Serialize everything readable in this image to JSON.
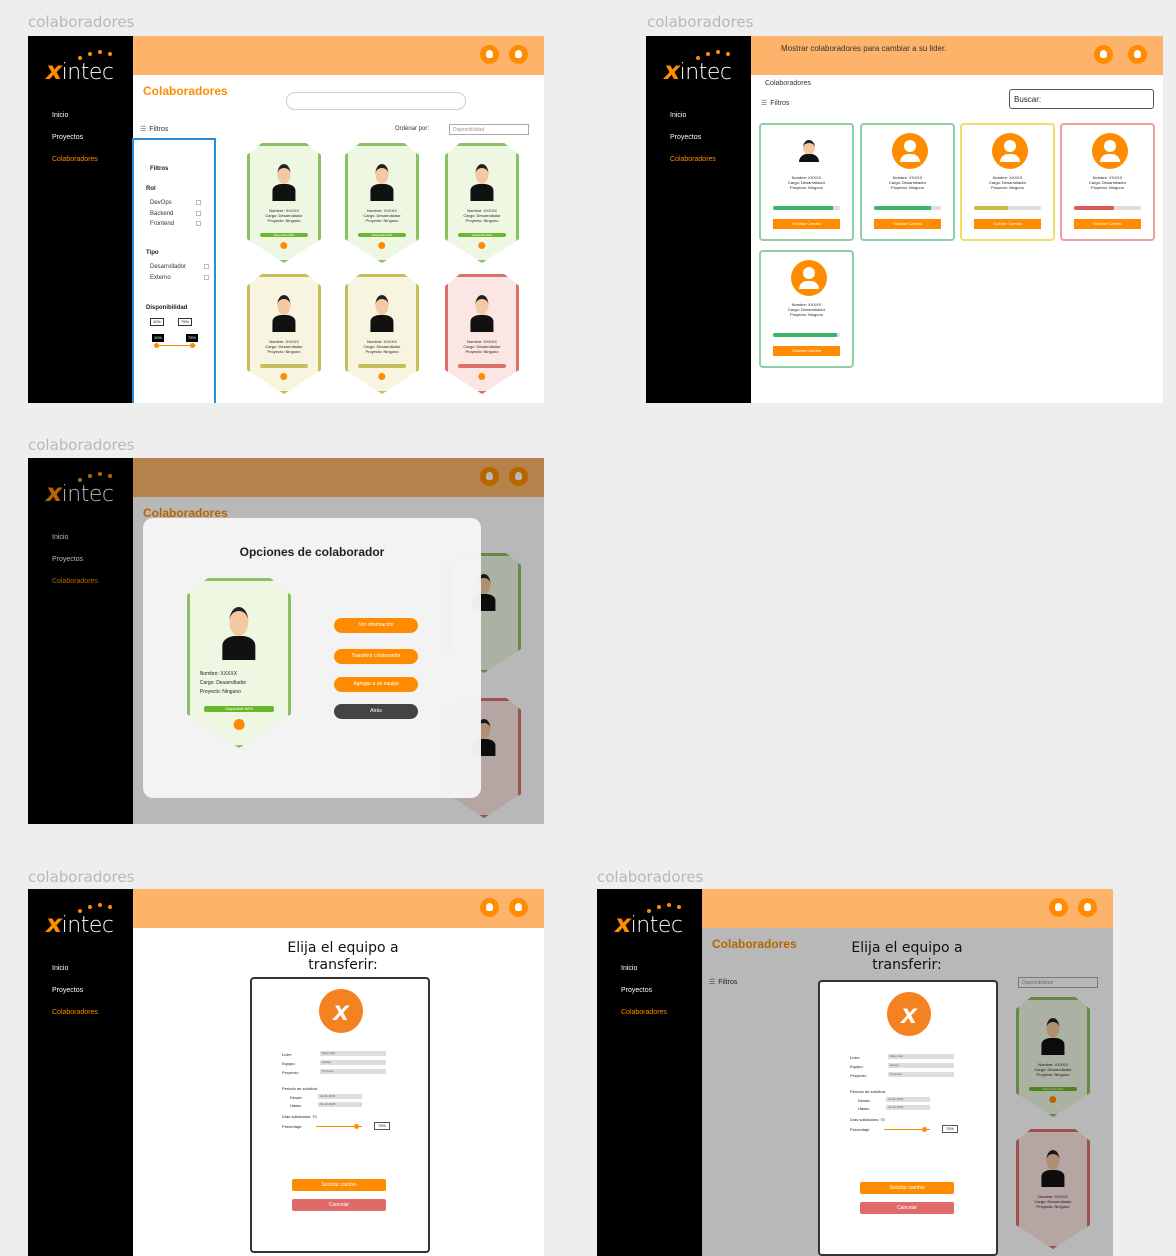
{
  "frame_label": "colaboradores",
  "brand": {
    "x": "x",
    "rest": "intec",
    "accent": "#ff8c00",
    "topbar": "#fdb46a"
  },
  "nav": {
    "inicio": "Inicio",
    "proyectos": "Proyectos",
    "colaboradores": "Colaboradores"
  },
  "page_title": "Colaboradores",
  "filters_label": "Filtros",
  "sort_label": "Ordenar por:",
  "sort_value": "Disponibilidad",
  "filter_panel": {
    "title": "Filtros",
    "rol": "Rol",
    "rol_options": [
      "DevOps",
      "Backend",
      "Frontend"
    ],
    "tipo": "Tipo",
    "tipo_options": [
      "Desarrollador",
      "Externo"
    ],
    "disponibilidad": "Disponibilidad",
    "min": "10%",
    "max": "75%"
  },
  "card_lines": [
    "Nombre: XXXXX",
    "Cargo: Desarrollador",
    "Proyecto: Ninguno"
  ],
  "status_text": "Disponible 80%",
  "top_message": "Mostrar colaboradores para cambiar a su lider.",
  "right_title": "Colaboradores",
  "search_label": "Buscar:",
  "right_card_lines": [
    "Nombre: XXXXX",
    "Cargo: Desarrollador",
    "Proyecto: Ninguno"
  ],
  "right_btn": "Solicitar Cambio",
  "options_modal": {
    "title": "Opciones de colaborador",
    "buttons": [
      "Ver información",
      "Transferir colaborador",
      "Agregar a un equipo",
      "Atrás"
    ]
  },
  "transfer_modal": {
    "title": "Elija el equipo a transferir:",
    "labels": [
      "Líder:",
      "Equipo:",
      "Proyecto:"
    ],
    "values": [
      "Elige líder",
      "Equipo",
      "Proyecto"
    ],
    "periodo": "Periodo de solicitud:",
    "desde": "Desde:",
    "hasta": "Hasta:",
    "date_from": "01-01-2025",
    "date_to": "30-12-2025",
    "dias": "Días solicitados: 70",
    "porcentaje": "Porcentaje:",
    "pct_value": "75%",
    "primary_btn": "Solicitar cambio",
    "cancel_btn": "Cancelar"
  }
}
